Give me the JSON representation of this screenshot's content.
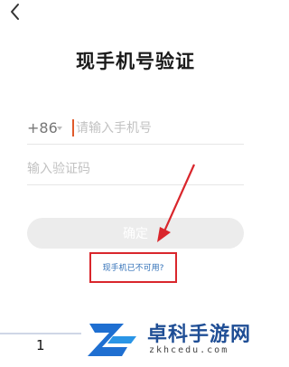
{
  "header": {
    "back_icon": "chevron-left-icon"
  },
  "page": {
    "title": "现手机号验证"
  },
  "form": {
    "country_code": "+86",
    "phone_placeholder": "请输入手机号",
    "code_placeholder": "输入验证码",
    "confirm_label": "确定"
  },
  "links": {
    "phone_unavailable": "现手机已不可用?"
  },
  "annotation": {
    "color": "#d9262c"
  },
  "pager": {
    "page_number": "1"
  },
  "watermark": {
    "title": "卓科手游网",
    "url": "zkhcedu.com"
  },
  "colors": {
    "link": "#2f6fb7",
    "cursor": "#e05a2b",
    "button_bg": "#ececec",
    "brand": "#1f4e95"
  }
}
